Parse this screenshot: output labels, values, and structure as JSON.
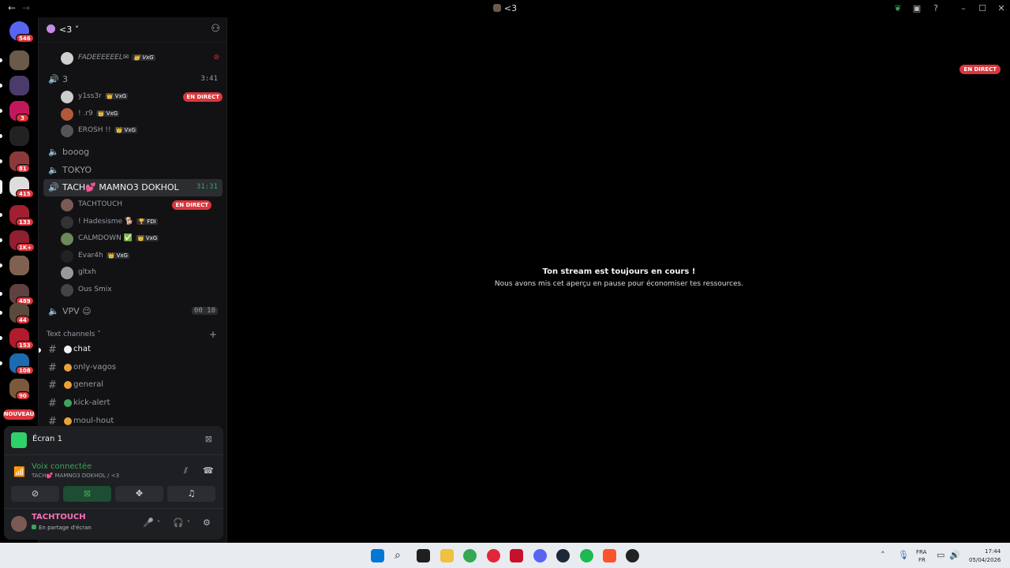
{
  "window": {
    "title": "<3",
    "back": "←",
    "forward": "→"
  },
  "guilds": {
    "items": [
      {
        "badge": "546",
        "color": "#5865f2"
      },
      {
        "badge": "",
        "color": "#6b5a4a"
      },
      {
        "badge": "",
        "color": "#4a3b6b"
      },
      {
        "badge": "3",
        "color": "#c2185b"
      },
      {
        "badge": "",
        "color": "#222222"
      },
      {
        "badge": "81",
        "color": "#8a3a3a"
      },
      {
        "badge": "415",
        "color": "#dddddd"
      },
      {
        "badge": "133",
        "color": "#a02030"
      },
      {
        "badge": "1K+",
        "color": "#902030"
      },
      {
        "badge": "",
        "color": "#806050"
      },
      {
        "badge": "489",
        "color": "#604040"
      },
      {
        "badge": "44",
        "color": "#5a4a3a"
      },
      {
        "badge": "153",
        "color": "#b01c2c"
      },
      {
        "badge": "108",
        "color": "#1c6ab0"
      },
      {
        "badge": "90",
        "color": "#7a5a3a"
      }
    ],
    "new_label": "NOUVEAU"
  },
  "server": {
    "name": "<3"
  },
  "voice_channels": [
    {
      "name": "3",
      "time": "3:41",
      "active": true
    },
    {
      "name": "booog",
      "time": "",
      "active": false
    },
    {
      "name": "TOKYO",
      "time": "",
      "active": false
    },
    {
      "name": "TACH💕 MAMNO3 DOKHOL",
      "time": "31:31",
      "active": true
    },
    {
      "name": "VPV 😉",
      "time": "00 10",
      "active": false
    }
  ],
  "users_top": [
    {
      "name": "FADEEEEEEL✉",
      "tag": "👑 VxG",
      "color": "#d0d0d0"
    }
  ],
  "users_ch3": [
    {
      "name": "y1ss3r",
      "tag": "👑 VxG",
      "live": "EN DIRECT",
      "color": "#cccccc"
    },
    {
      "name": "! .r9",
      "tag": "👑 VxG",
      "live": "",
      "color": "#b05a3a"
    },
    {
      "name": "EROSH !!",
      "tag": "👑 VxG",
      "live": "",
      "color": "#555555"
    }
  ],
  "users_tach": [
    {
      "name": "TACHTOUCH",
      "tag": "",
      "live": "EN DIRECT",
      "color": "#7a5a52"
    },
    {
      "name": "! Hadesisme 🐕",
      "tag": "🏆 FDI",
      "live": "",
      "color": "#333333"
    },
    {
      "name": "CALMDOWN ✅",
      "tag": "👑 VxG",
      "live": "",
      "color": "#6a8a5a"
    },
    {
      "name": "Evar4h",
      "tag": "👑 VxG",
      "live": "",
      "color": "#222222"
    },
    {
      "name": "gltxh",
      "tag": "",
      "live": "",
      "color": "#999999"
    },
    {
      "name": "Ous Smix",
      "tag": "",
      "live": "",
      "color": "#444444"
    }
  ],
  "text_category": "Text channels ˅",
  "text_channels": [
    {
      "name": "chat",
      "emoji_color": "#f2f3f5",
      "unread": true
    },
    {
      "name": "only-vagos",
      "emoji_color": "#e8a33a",
      "unread": false
    },
    {
      "name": "general",
      "emoji_color": "#f0a030",
      "unread": false
    },
    {
      "name": "kick-alert",
      "emoji_color": "#3ba55d",
      "unread": false
    },
    {
      "name": "moul-hout",
      "emoji_color": "#e8a33a",
      "unread": false
    }
  ],
  "stream_panel": {
    "screen_name": "Écran 1",
    "voice_status": "Voix connectée",
    "voice_location": "TACH💕 MAMNO3 DOKHOL / <3"
  },
  "user_panel": {
    "name": "TACHTOUCH",
    "status": "En partage d'écran"
  },
  "main": {
    "live_badge": "EN DIRECT",
    "heading": "Ton stream est toujours en cours !",
    "subheading": "Nous avons mis cet aperçu en pause pour économiser tes ressources."
  },
  "taskbar": {
    "lang_top": "FRA",
    "lang_bottom": "FR",
    "time": "17:44",
    "date": "05/04/2026"
  },
  "colors": {
    "live": "#da373c",
    "voice_green": "#3ba55d",
    "accent_pink": "#ff6ebc"
  }
}
